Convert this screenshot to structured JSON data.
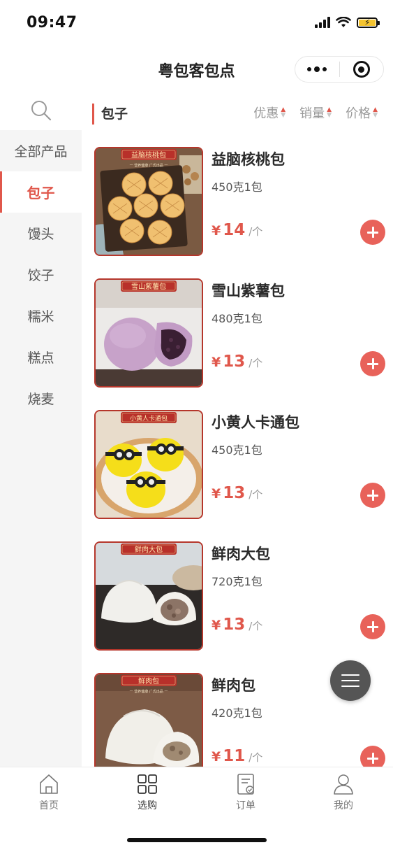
{
  "status_bar": {
    "time": "09:47"
  },
  "nav": {
    "title": "粤包客包点"
  },
  "sidebar": {
    "items": [
      {
        "label": "全部产品",
        "active": false
      },
      {
        "label": "包子",
        "active": true
      },
      {
        "label": "馒头",
        "active": false
      },
      {
        "label": "饺子",
        "active": false
      },
      {
        "label": "糯米",
        "active": false
      },
      {
        "label": "糕点",
        "active": false
      },
      {
        "label": "烧麦",
        "active": false
      }
    ]
  },
  "content": {
    "category_title": "包子",
    "sort": [
      {
        "label": "优惠"
      },
      {
        "label": "销量"
      },
      {
        "label": "价格"
      }
    ]
  },
  "products": [
    {
      "name": "益脑核桃包",
      "spec": "450克1包",
      "currency": "¥",
      "price": "14",
      "unit": "/个",
      "image_label": "益脑核桃包",
      "image_sub": "一 营养健康 广式出品 一"
    },
    {
      "name": "雪山紫薯包",
      "spec": "480克1包",
      "currency": "¥",
      "price": "13",
      "unit": "/个",
      "image_label": "雪山紫薯包",
      "image_sub": ""
    },
    {
      "name": "小黄人卡通包",
      "spec": "450克1包",
      "currency": "¥",
      "price": "13",
      "unit": "/个",
      "image_label": "小黄人卡通包",
      "image_sub": ""
    },
    {
      "name": "鲜肉大包",
      "spec": "720克1包",
      "currency": "¥",
      "price": "13",
      "unit": "/个",
      "image_label": "鲜肉大包",
      "image_sub": ""
    },
    {
      "name": "鲜肉包",
      "spec": "420克1包",
      "currency": "¥",
      "price": "11",
      "unit": "/个",
      "image_label": "鲜肉包",
      "image_sub": "一 营养健康 广式出品 一"
    }
  ],
  "tabbar": {
    "items": [
      {
        "label": "首页",
        "icon": "home-icon"
      },
      {
        "label": "选购",
        "icon": "grid-icon"
      },
      {
        "label": "订单",
        "icon": "order-icon"
      },
      {
        "label": "我的",
        "icon": "user-icon"
      }
    ]
  },
  "colors": {
    "accent": "#e0574b",
    "add_button": "#e8625a",
    "sidebar_bg": "#f5f5f5"
  }
}
